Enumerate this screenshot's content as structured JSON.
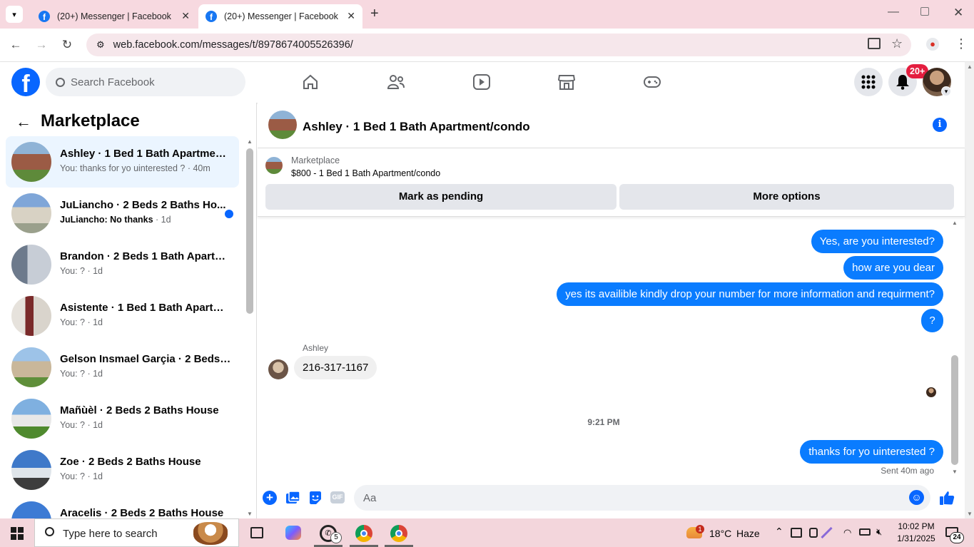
{
  "browser": {
    "tabs": [
      {
        "title": "(20+) Messenger | Facebook"
      },
      {
        "title": "(20+) Messenger | Facebook"
      }
    ],
    "url": "web.facebook.com/messages/t/8978674005526396/"
  },
  "header": {
    "search_placeholder": "Search Facebook",
    "notification_badge": "20+"
  },
  "sidebar": {
    "title": "Marketplace",
    "items": [
      {
        "title": "Ashley · 1 Bed 1 Bath Apartment...",
        "preview": "You: thanks for yo uinterested ? · 40m",
        "unread": false
      },
      {
        "title": "JuLiancho · 2 Beds 2 Baths Ho...",
        "preview": "JuLiancho: No thanks",
        "time": " · 1d",
        "unread": true
      },
      {
        "title": "Brandon · 2 Beds 1 Bath Apartm...",
        "preview": "You: ? · 1d",
        "unread": false
      },
      {
        "title": "Asistente · 1 Bed 1 Bath Apartm...",
        "preview": "You: ? · 1d",
        "unread": false
      },
      {
        "title": "Gelson Insmael Garçia · 2 Beds ...",
        "preview": "You: ? · 1d",
        "unread": false
      },
      {
        "title": "Mañùèl · 2 Beds 2 Baths House",
        "preview": "You: ? · 1d",
        "unread": false
      },
      {
        "title": "Zoe · 2 Beds 2 Baths House",
        "preview": "You: ? · 1d",
        "unread": false
      },
      {
        "title": "Aracelis · 2 Beds 2 Baths House",
        "preview": "",
        "unread": false
      }
    ]
  },
  "chat": {
    "title": "Ashley · 1 Bed 1 Bath Apartment/condo",
    "listing_source": "Marketplace",
    "listing_detail": "$800 - 1 Bed 1 Bath Apartment/condo",
    "mark_pending": "Mark as pending",
    "more_options": "More options",
    "messages_out": [
      "Yes, are you interested?",
      "how are you dear",
      "yes its availible kindly drop your number for more information and requirment?",
      "?"
    ],
    "sender_name": "Ashley",
    "message_in": "216-317-1167",
    "timestamp": "9:21 PM",
    "last_message": "thanks for yo uinterested ?",
    "sent_status": "Sent 40m ago",
    "composer_placeholder": "Aa"
  },
  "taskbar": {
    "search_placeholder": "Type here to search",
    "whatsapp_badge": "5",
    "weather_badge": "1",
    "temperature": "18°C",
    "weather": "Haze",
    "time": "10:02 PM",
    "date": "1/31/2025",
    "notification_count": "24"
  },
  "colors": {
    "accent": "#0a7cff",
    "facebook_blue": "#1877f2",
    "tabbar": "#f7d9e0"
  }
}
